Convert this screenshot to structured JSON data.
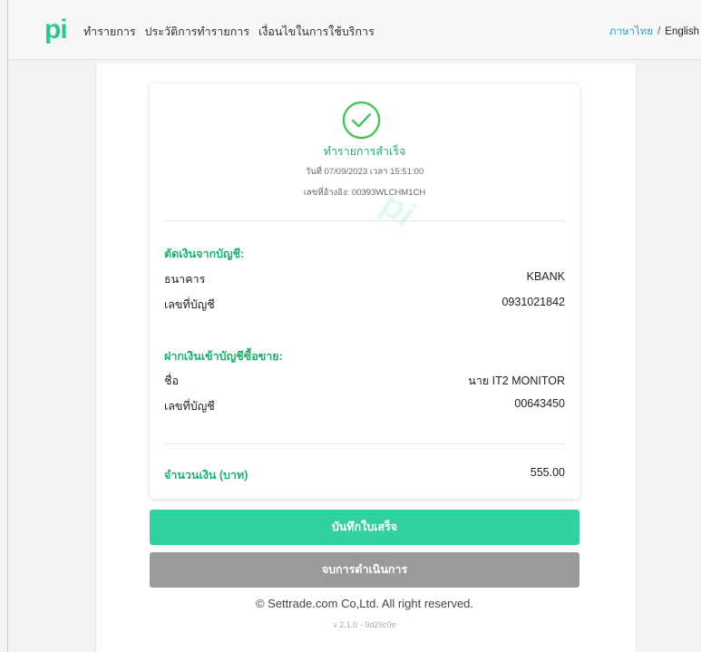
{
  "header": {
    "logo": "pi",
    "nav": [
      "ทำรายการ",
      "ประวัติการทำรายการ",
      "เงื่อนไขในการใช้บริการ"
    ],
    "lang_thai": "ภาษาไทย",
    "lang_separator": "/",
    "lang_english": "English"
  },
  "receipt": {
    "status": "ทำรายการสำเร็จ",
    "datetime": "วันที่ 07/09/2023 เวลา 15:51:00",
    "reference": "เลขที่อ้างอิง: 00393WLCHM1CH",
    "watermark": "pi",
    "debit": {
      "title": "ตัดเงินจากบัญชี:",
      "bank_label": "ธนาคาร",
      "bank_value": "KBANK",
      "account_label": "เลขที่บัญชี",
      "account_value": "0931021842"
    },
    "credit": {
      "title": "ฝากเงินเข้าบัญชีซื้อขาย:",
      "name_label": "ชื่อ",
      "name_value": "นาย IT2 MONITOR",
      "account_label": "เลขที่บัญชี",
      "account_value": "00643450"
    },
    "amount_label": "จำนวนเงิน (บาท)",
    "amount_value": "555.00"
  },
  "actions": {
    "save_label": "บันทึกใบเสร็จ",
    "end_label": "จบการดำเนินการ"
  },
  "footer": {
    "copyright": "© Settrade.com Co,Ltd. All right reserved.",
    "version": "v 2.1.0 - 9d29c0e"
  },
  "colors": {
    "brand_green": "#2fc497",
    "success_green": "#1faf6f",
    "button_save": "#33d0a0",
    "button_end": "#9a9a9a",
    "link_blue": "#2aa0c7"
  },
  "icons": {
    "success": "check-circle-icon"
  }
}
